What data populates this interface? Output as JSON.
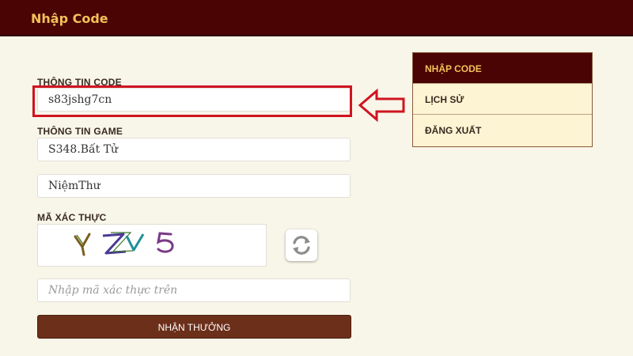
{
  "header": {
    "title": "Nhập Code"
  },
  "form": {
    "code_label": "THÔNG TIN CODE",
    "code_value": "s83jshg7cn",
    "game_label": "THÔNG TIN GAME",
    "server_value": "S348.Bất Tử",
    "character_value": "NiệmThư",
    "captcha_label": "MÃ XÁC THỰC",
    "captcha_text": "YZV5",
    "captcha_placeholder": "Nhập mã xác thực trên",
    "submit_label": "NHẬN THƯỞNG"
  },
  "sidebar": {
    "items": [
      {
        "label": "NHẬP CODE",
        "active": true
      },
      {
        "label": "LỊCH SỬ",
        "active": false
      },
      {
        "label": "ĐĂNG XUẤT",
        "active": false
      }
    ]
  },
  "colors": {
    "header_bg": "#4a0404",
    "header_text": "#f2c15a",
    "page_bg": "#f8f6e9",
    "highlight": "#d01420",
    "button_bg": "#6b2f1a",
    "menu_bg": "#fdf4d4"
  },
  "icons": {
    "arrow": "left-arrow-icon",
    "refresh": "refresh-icon"
  }
}
